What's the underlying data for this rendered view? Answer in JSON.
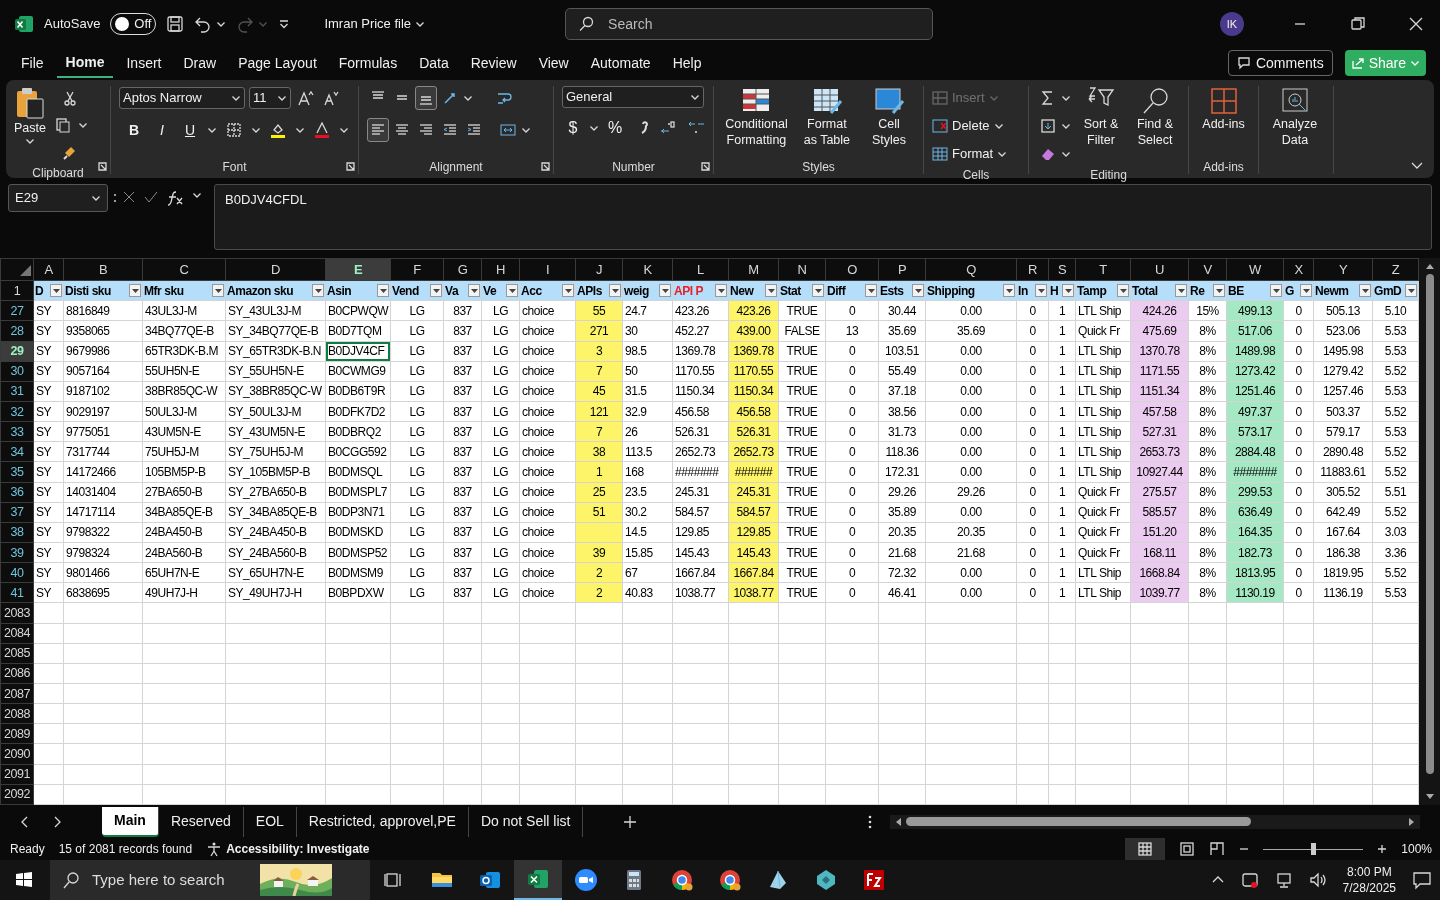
{
  "title_bar": {
    "autosave_label": "AutoSave",
    "autosave": {
      "on": false,
      "label": "Off"
    },
    "redo": {
      "disabled": true
    },
    "file_name": "Imran Price file",
    "search": {
      "placeholder": "Search"
    },
    "avatar": "IK"
  },
  "menu": {
    "tabs": [
      {
        "label": "File",
        "selected": false
      },
      {
        "label": "Home",
        "selected": true
      },
      {
        "label": "Insert",
        "selected": false
      },
      {
        "label": "Draw",
        "selected": false
      },
      {
        "label": "Page Layout",
        "selected": false
      },
      {
        "label": "Formulas",
        "selected": false
      },
      {
        "label": "Data",
        "selected": false
      },
      {
        "label": "Review",
        "selected": false
      },
      {
        "label": "View",
        "selected": false
      },
      {
        "label": "Automate",
        "selected": false
      },
      {
        "label": "Help",
        "selected": false
      }
    ],
    "comments": "Comments",
    "share": "Share"
  },
  "ribbon": {
    "clipboard": {
      "label": "Clipboard",
      "paste": "Paste"
    },
    "font": {
      "label": "Font",
      "name": "Aptos Narrow",
      "size": "11",
      "bold": "B",
      "italic": "I",
      "underline": "U"
    },
    "alignment": {
      "label": "Alignment",
      "vertical": [
        {
          "kind": "top",
          "selected": false
        },
        {
          "kind": "middle",
          "selected": false
        },
        {
          "kind": "bottom",
          "selected": true
        }
      ],
      "horizontal": [
        {
          "kind": "left",
          "selected": true
        },
        {
          "kind": "center",
          "selected": false
        },
        {
          "kind": "right",
          "selected": false
        }
      ]
    },
    "number": {
      "label": "Number",
      "format": "General",
      "currency": "$",
      "percent": "%"
    },
    "styles": {
      "label": "Styles",
      "buttons": [
        "Conditional Formatting",
        "Format as Table",
        "Cell Styles"
      ]
    },
    "cells": {
      "label": "Cells",
      "buttons": [
        {
          "label": "Insert",
          "disabled": true
        },
        {
          "label": "Delete",
          "disabled": false
        },
        {
          "label": "Format",
          "disabled": false
        }
      ]
    },
    "editing": {
      "label": "Editing",
      "buttons": [
        "Sort & Filter",
        "Find & Select"
      ]
    },
    "addins": {
      "label": "Add-ins",
      "button": "Add-ins"
    },
    "analyze": {
      "button": "Analyze Data"
    }
  },
  "formula_bar": {
    "name_box": "E29",
    "formula": "B0DJV4CFDL"
  },
  "grid": {
    "columns": [
      {
        "letter": "A",
        "header": "D",
        "centered": false,
        "color": "#ffffff",
        "highlighted": false,
        "selected": false
      },
      {
        "letter": "B",
        "header": "Disti sku",
        "centered": false,
        "color": "#ffffff",
        "highlighted": false,
        "selected": false
      },
      {
        "letter": "C",
        "header": "Mfr sku",
        "centered": false,
        "color": "#ffffff",
        "highlighted": false,
        "selected": false
      },
      {
        "letter": "D",
        "header": "Amazon sku",
        "centered": false,
        "color": "#ffffff",
        "highlighted": false,
        "selected": false
      },
      {
        "letter": "E",
        "header": "Asin",
        "centered": false,
        "color": "#ffffff",
        "highlighted": false,
        "selected": true
      },
      {
        "letter": "F",
        "header": "Vend",
        "centered": true,
        "color": "#ffffff",
        "highlighted": false,
        "selected": false
      },
      {
        "letter": "G",
        "header": "Va",
        "centered": true,
        "color": "#ffffff",
        "highlighted": false,
        "selected": false
      },
      {
        "letter": "H",
        "header": "Ve",
        "centered": true,
        "color": "#ffffff",
        "highlighted": false,
        "selected": false
      },
      {
        "letter": "I",
        "header": "Acc",
        "centered": false,
        "color": "#ffffff",
        "highlighted": false,
        "selected": false
      },
      {
        "letter": "J",
        "header": "APIs",
        "centered": true,
        "color": "#fdf46a",
        "highlighted": false,
        "selected": false
      },
      {
        "letter": "K",
        "header": "weig",
        "centered": false,
        "color": "#ffffff",
        "highlighted": false,
        "selected": false
      },
      {
        "letter": "L",
        "header": "API P",
        "centered": false,
        "color": "#ffffff",
        "highlighted": true,
        "selected": false
      },
      {
        "letter": "M",
        "header": "New",
        "centered": true,
        "color": "#fdf46a",
        "highlighted": false,
        "selected": false
      },
      {
        "letter": "N",
        "header": "Stat",
        "centered": true,
        "color": "#ffffff",
        "highlighted": false,
        "selected": false
      },
      {
        "letter": "O",
        "header": "Diff",
        "centered": true,
        "color": "#ffffff",
        "highlighted": false,
        "selected": false
      },
      {
        "letter": "P",
        "header": "Ests",
        "centered": true,
        "color": "#ffffff",
        "highlighted": false,
        "selected": false
      },
      {
        "letter": "Q",
        "header": "Shipping",
        "centered": true,
        "color": "#ffffff",
        "highlighted": false,
        "selected": false
      },
      {
        "letter": "R",
        "header": "In",
        "centered": true,
        "color": "#ffffff",
        "highlighted": false,
        "selected": false
      },
      {
        "letter": "S",
        "header": "H",
        "centered": true,
        "color": "#ffffff",
        "highlighted": false,
        "selected": false
      },
      {
        "letter": "T",
        "header": "Tamp",
        "centered": false,
        "color": "#ffffff",
        "highlighted": false,
        "selected": false
      },
      {
        "letter": "U",
        "header": "Total",
        "centered": true,
        "color": "#ebcbef",
        "highlighted": false,
        "selected": false
      },
      {
        "letter": "V",
        "header": "Re",
        "centered": true,
        "color": "#ffffff",
        "highlighted": false,
        "selected": false
      },
      {
        "letter": "W",
        "header": "BE",
        "centered": true,
        "color": "#a5e8c4",
        "highlighted": false,
        "selected": false
      },
      {
        "letter": "X",
        "header": "G",
        "centered": true,
        "color": "#ffffff",
        "highlighted": false,
        "selected": false
      },
      {
        "letter": "Y",
        "header": "Newm",
        "centered": true,
        "color": "#ffffff",
        "highlighted": false,
        "selected": false
      },
      {
        "letter": "Z",
        "header": "GmD",
        "centered": true,
        "color": "#ffffff",
        "highlighted": false,
        "selected": false
      }
    ],
    "rows": [
      {
        "number": "27",
        "selected": false,
        "cells": [
          "SY",
          "8816849",
          "43UL3J-M",
          "SY_43UL3J-M",
          "B0CPWQW",
          "LG",
          "837",
          "LG",
          "choice",
          "55",
          "24.7",
          "423.26",
          "423.26",
          "TRUE",
          "0",
          "30.44",
          "0.00",
          "0",
          "1",
          "LTL Ship",
          "424.26",
          "15%",
          "499.13",
          "0",
          "505.13",
          "5.10"
        ]
      },
      {
        "number": "28",
        "selected": false,
        "cells": [
          "SY",
          "9358065",
          "34BQ77QE-B",
          "SY_34BQ77QE-B",
          "B0D7TQM",
          "LG",
          "837",
          "LG",
          "choice",
          "271",
          "30",
          "452.27",
          "439.00",
          "FALSE",
          "13",
          "35.69",
          "35.69",
          "0",
          "1",
          "Quick Fr",
          "475.69",
          "8%",
          "517.06",
          "0",
          "523.06",
          "5.53"
        ]
      },
      {
        "number": "29",
        "selected": true,
        "cells": [
          "SY",
          "9679986",
          "65TR3DK-B.M",
          "SY_65TR3DK-B.N",
          "B0DJV4CF",
          "LG",
          "837",
          "LG",
          "choice",
          "3",
          "98.5",
          "1369.78",
          "1369.78",
          "TRUE",
          "0",
          "103.51",
          "0.00",
          "0",
          "1",
          "LTL Ship",
          "1370.78",
          "8%",
          "1489.98",
          "0",
          "1495.98",
          "5.53"
        ]
      },
      {
        "number": "30",
        "selected": false,
        "cells": [
          "SY",
          "9057164",
          "55UH5N-E",
          "SY_55UH5N-E",
          "B0CWMG9",
          "LG",
          "837",
          "LG",
          "choice",
          "7",
          "50",
          "1170.55",
          "1170.55",
          "TRUE",
          "0",
          "55.49",
          "0.00",
          "0",
          "1",
          "LTL Ship",
          "1171.55",
          "8%",
          "1273.42",
          "0",
          "1279.42",
          "5.52"
        ]
      },
      {
        "number": "31",
        "selected": false,
        "cells": [
          "SY",
          "9187102",
          "38BR85QC-W",
          "SY_38BR85QC-W",
          "B0DB6T9R",
          "LG",
          "837",
          "LG",
          "choice",
          "45",
          "31.5",
          "1150.34",
          "1150.34",
          "TRUE",
          "0",
          "37.18",
          "0.00",
          "0",
          "1",
          "LTL Ship",
          "1151.34",
          "8%",
          "1251.46",
          "0",
          "1257.46",
          "5.53"
        ]
      },
      {
        "number": "32",
        "selected": false,
        "cells": [
          "SY",
          "9029197",
          "50UL3J-M",
          "SY_50UL3J-M",
          "B0DFK7D2",
          "LG",
          "837",
          "LG",
          "choice",
          "121",
          "32.9",
          "456.58",
          "456.58",
          "TRUE",
          "0",
          "38.56",
          "0.00",
          "0",
          "1",
          "LTL Ship",
          "457.58",
          "8%",
          "497.37",
          "0",
          "503.37",
          "5.52"
        ]
      },
      {
        "number": "33",
        "selected": false,
        "cells": [
          "SY",
          "9775051",
          "43UM5N-E",
          "SY_43UM5N-E",
          "B0DBRQ2",
          "LG",
          "837",
          "LG",
          "choice",
          "7",
          "26",
          "526.31",
          "526.31",
          "TRUE",
          "0",
          "31.73",
          "0.00",
          "0",
          "1",
          "LTL Ship",
          "527.31",
          "8%",
          "573.17",
          "0",
          "579.17",
          "5.53"
        ]
      },
      {
        "number": "34",
        "selected": false,
        "cells": [
          "SY",
          "7317744",
          "75UH5J-M",
          "SY_75UH5J-M",
          "B0CGG592",
          "LG",
          "837",
          "LG",
          "choice",
          "38",
          "113.5",
          "2652.73",
          "2652.73",
          "TRUE",
          "0",
          "118.36",
          "0.00",
          "0",
          "1",
          "LTL Ship",
          "2653.73",
          "8%",
          "2884.48",
          "0",
          "2890.48",
          "5.52"
        ]
      },
      {
        "number": "35",
        "selected": false,
        "cells": [
          "SY",
          "14172466",
          "105BM5P-B",
          "SY_105BM5P-B",
          "B0DMSQL",
          "LG",
          "837",
          "LG",
          "choice",
          "1",
          "168",
          "#######",
          "######",
          "TRUE",
          "0",
          "172.31",
          "0.00",
          "0",
          "1",
          "LTL Ship",
          "10927.44",
          "8%",
          "#######",
          "0",
          "11883.61",
          "5.52"
        ]
      },
      {
        "number": "36",
        "selected": false,
        "cells": [
          "SY",
          "14031404",
          "27BA650-B",
          "SY_27BA650-B",
          "B0DMSPL7",
          "LG",
          "837",
          "LG",
          "choice",
          "25",
          "23.5",
          "245.31",
          "245.31",
          "TRUE",
          "0",
          "29.26",
          "29.26",
          "0",
          "1",
          "Quick Fr",
          "275.57",
          "8%",
          "299.53",
          "0",
          "305.52",
          "5.51"
        ]
      },
      {
        "number": "37",
        "selected": false,
        "cells": [
          "SY",
          "14717114",
          "34BA85QE-B",
          "SY_34BA85QE-B",
          "B0DP3N71",
          "LG",
          "837",
          "LG",
          "choice",
          "51",
          "30.2",
          "584.57",
          "584.57",
          "TRUE",
          "0",
          "35.89",
          "0.00",
          "0",
          "1",
          "Quick Fr",
          "585.57",
          "8%",
          "636.49",
          "0",
          "642.49",
          "5.52"
        ]
      },
      {
        "number": "38",
        "selected": false,
        "cells": [
          "SY",
          "9798322",
          "24BA450-B",
          "SY_24BA450-B",
          "B0DMSKD",
          "LG",
          "837",
          "LG",
          "choice",
          "",
          "14.5",
          "129.85",
          "129.85",
          "TRUE",
          "0",
          "20.35",
          "20.35",
          "0",
          "1",
          "Quick Fr",
          "151.20",
          "8%",
          "164.35",
          "0",
          "167.64",
          "3.03"
        ]
      },
      {
        "number": "39",
        "selected": false,
        "cells": [
          "SY",
          "9798324",
          "24BA560-B",
          "SY_24BA560-B",
          "B0DMSP52",
          "LG",
          "837",
          "LG",
          "choice",
          "39",
          "15.85",
          "145.43",
          "145.43",
          "TRUE",
          "0",
          "21.68",
          "21.68",
          "0",
          "1",
          "Quick Fr",
          "168.11",
          "8%",
          "182.73",
          "0",
          "186.38",
          "3.36"
        ]
      },
      {
        "number": "40",
        "selected": false,
        "cells": [
          "SY",
          "9801466",
          "65UH7N-E",
          "SY_65UH7N-E",
          "B0DMSM9",
          "LG",
          "837",
          "LG",
          "choice",
          "2",
          "67",
          "1667.84",
          "1667.84",
          "TRUE",
          "0",
          "72.32",
          "0.00",
          "0",
          "1",
          "LTL Ship",
          "1668.84",
          "8%",
          "1813.95",
          "0",
          "1819.95",
          "5.52"
        ]
      },
      {
        "number": "41",
        "selected": false,
        "cells": [
          "SY",
          "6838695",
          "49UH7J-H",
          "SY_49UH7J-H",
          "B0BPDXW",
          "LG",
          "837",
          "LG",
          "choice",
          "2",
          "40.83",
          "1038.77",
          "1038.77",
          "TRUE",
          "0",
          "46.41",
          "0.00",
          "0",
          "1",
          "LTL Ship",
          "1039.77",
          "8%",
          "1130.19",
          "0",
          "1136.19",
          "5.53"
        ]
      }
    ],
    "header_row": "1",
    "empty_rows": [
      "2083",
      "2084",
      "2085",
      "2086",
      "2087",
      "2088",
      "2089",
      "2090",
      "2091",
      "2092"
    ]
  },
  "sheet_tabs": [
    {
      "label": "Main",
      "selected": true
    },
    {
      "label": "Reserved",
      "selected": false
    },
    {
      "label": "EOL",
      "selected": false
    },
    {
      "label": "Restricted, approvel,PE",
      "selected": false
    },
    {
      "label": "Do not Sell list",
      "selected": false
    }
  ],
  "status_bar": {
    "mode": "Ready",
    "records": "15 of 2081 records found",
    "accessibility": "Accessibility: Investigate",
    "zoom": {
      "level": 0.5,
      "label": "100%"
    }
  },
  "taskbar": {
    "search": {
      "placeholder": "Type here to search"
    },
    "apps": [
      {
        "kind": "explorer",
        "active": false
      },
      {
        "kind": "outlook",
        "active": false
      },
      {
        "kind": "excel",
        "active": true
      },
      {
        "kind": "zoom",
        "active": false
      },
      {
        "kind": "calculator",
        "active": false
      },
      {
        "kind": "chrome",
        "active": false
      },
      {
        "kind": "chrome",
        "active": false
      },
      {
        "kind": "notes",
        "active": false
      },
      {
        "kind": "cube",
        "active": false
      },
      {
        "kind": "filezilla",
        "active": false
      }
    ],
    "time": "8:00 PM",
    "date": "7/28/2025"
  }
}
